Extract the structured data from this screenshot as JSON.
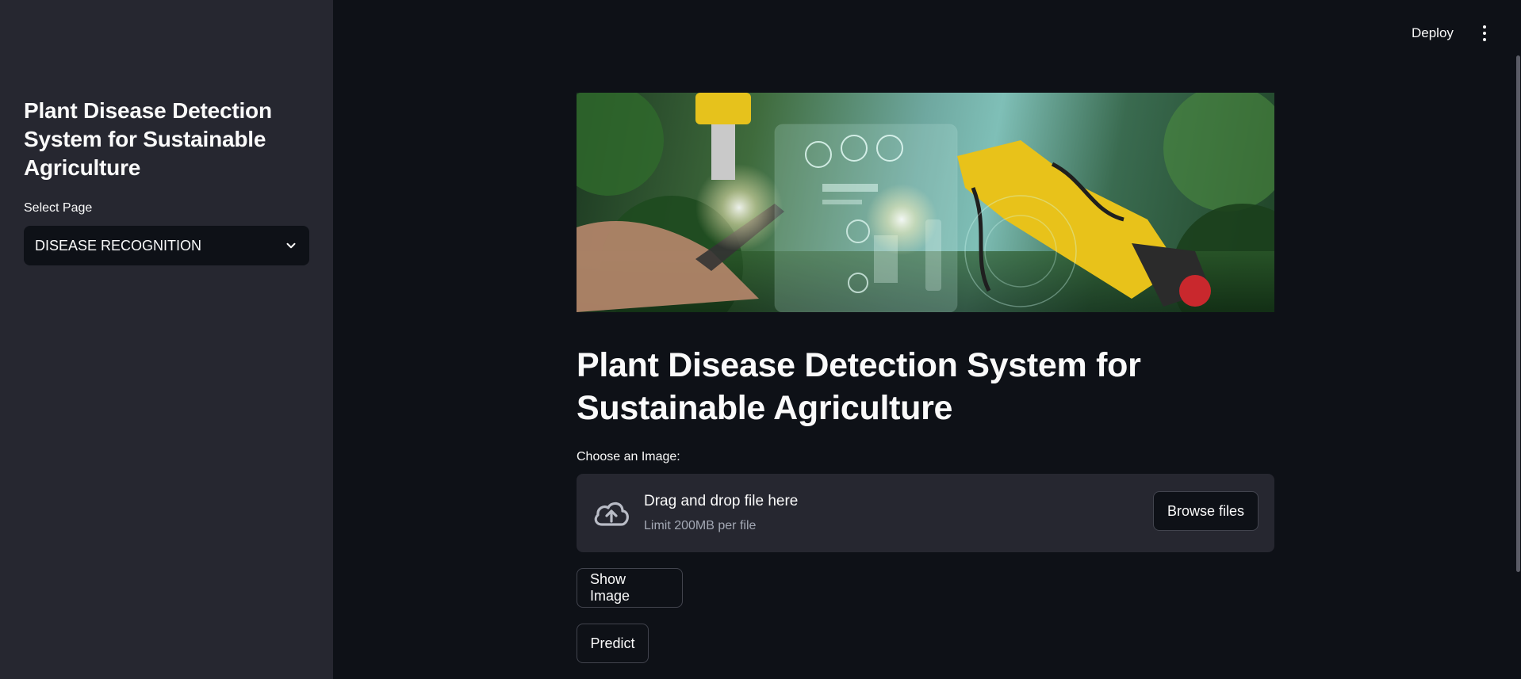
{
  "sidebar": {
    "title": "Plant Disease Detection System for Sustainable Agriculture",
    "select_label": "Select Page",
    "select_value": "DISEASE RECOGNITION"
  },
  "header": {
    "deploy_label": "Deploy",
    "menu_icon": "more-vert-icon"
  },
  "main": {
    "banner_icon": "agriculture-robot-banner",
    "title": "Plant Disease Detection System for Sustainable Agriculture",
    "uploader": {
      "label": "Choose an Image:",
      "drop_text": "Drag and drop file here",
      "limit_text": "Limit 200MB per file",
      "browse_label": "Browse files",
      "icon": "cloud-upload-icon"
    },
    "show_image_label": "Show Image",
    "predict_label": "Predict"
  },
  "colors": {
    "background": "#0e1117",
    "sidebar": "#262730",
    "text": "#fafafa",
    "muted": "#a3a8b4"
  }
}
